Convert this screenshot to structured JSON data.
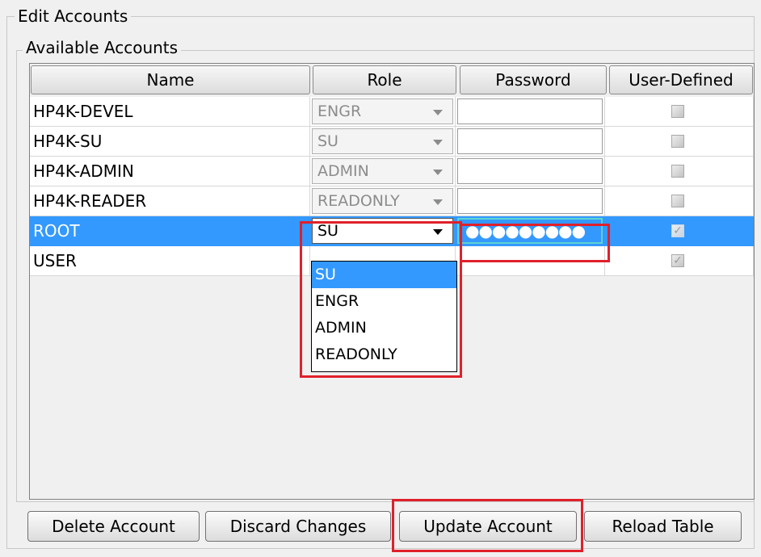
{
  "panel": {
    "title": "Edit Accounts"
  },
  "accounts_group": {
    "title": "Available Accounts"
  },
  "table": {
    "headers": {
      "name": "Name",
      "role": "Role",
      "password": "Password",
      "user_defined": "User-Defined"
    },
    "rows": [
      {
        "name": "HP4K-DEVEL",
        "role": "ENGR",
        "password": "",
        "user_defined": false
      },
      {
        "name": "HP4K-SU",
        "role": "SU",
        "password": "",
        "user_defined": false
      },
      {
        "name": "HP4K-ADMIN",
        "role": "ADMIN",
        "password": "",
        "user_defined": false
      },
      {
        "name": "HP4K-READER",
        "role": "READONLY",
        "password": "",
        "user_defined": false
      },
      {
        "name": "ROOT",
        "role": "SU",
        "password": "●●●●●●●●●",
        "user_defined": true,
        "selected": true
      },
      {
        "name": "USER",
        "role": "",
        "password": "",
        "user_defined": true
      }
    ]
  },
  "role_dropdown": {
    "selected": "SU",
    "options": [
      "SU",
      "ENGR",
      "ADMIN",
      "READONLY"
    ]
  },
  "buttons": {
    "delete": "Delete Account",
    "discard": "Discard Changes",
    "update": "Update Account",
    "reload": "Reload Table"
  },
  "colors": {
    "selection": "#3399ff",
    "highlight_annotation": "#e0202a",
    "panel_background": "#f0f0f0"
  }
}
